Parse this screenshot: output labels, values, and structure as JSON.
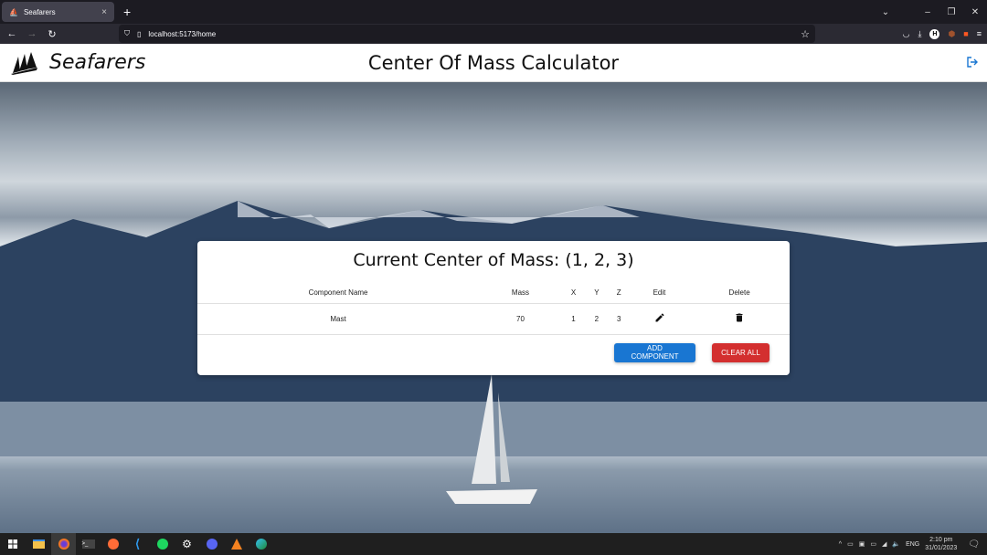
{
  "browser": {
    "tab_title": "Seafarers",
    "url": "localhost:5173/home"
  },
  "app": {
    "brand": "Seafarers",
    "title": "Center Of Mass Calculator"
  },
  "card": {
    "heading": "Current Center of Mass: (1, 2, 3)",
    "columns": [
      "Component Name",
      "Mass",
      "X",
      "Y",
      "Z",
      "Edit",
      "Delete"
    ],
    "rows": [
      {
        "name": "Mast",
        "mass": "70",
        "x": "1",
        "y": "2",
        "z": "3"
      }
    ],
    "add_label": "ADD COMPONENT",
    "clear_label": "CLEAR ALL"
  },
  "colors": {
    "primary": "#1976d2",
    "danger": "#d32f2f"
  },
  "taskbar": {
    "apps": [
      "start",
      "file-explorer",
      "firefox",
      "terminal",
      "postman",
      "vscode",
      "spotify",
      "settings",
      "discord",
      "vlc",
      "edge"
    ],
    "lang": "ENG",
    "time": "2:10 pm",
    "date": "31/01/2023"
  }
}
